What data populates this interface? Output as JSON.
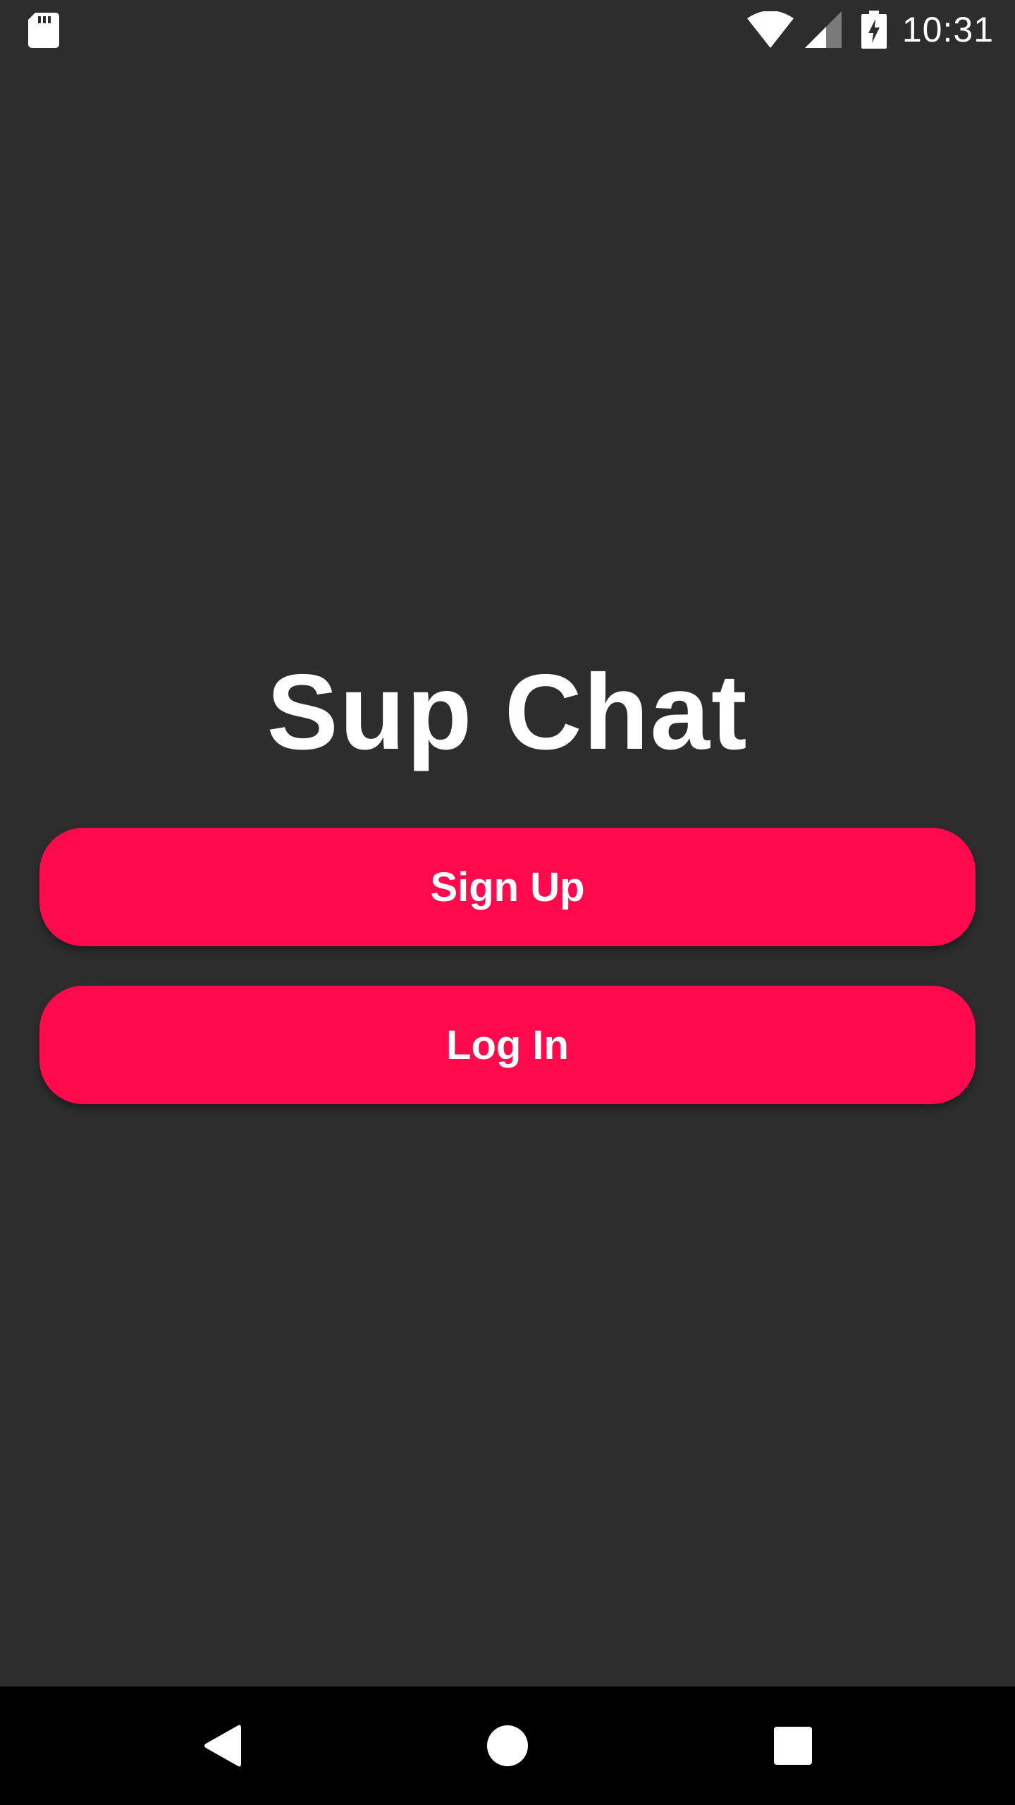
{
  "status_bar": {
    "time": "10:31",
    "icons": [
      "sd-card-icon",
      "wifi-icon",
      "cell-signal-icon",
      "battery-charging-icon"
    ]
  },
  "app": {
    "title": "Sup Chat"
  },
  "buttons": {
    "signup_label": "Sign Up",
    "login_label": "Log In"
  },
  "nav_bar": {
    "icons": [
      "back-icon",
      "home-icon",
      "recents-icon"
    ]
  },
  "colors": {
    "background": "#2d2d2d",
    "accent": "#ff0a4c",
    "text": "#ffffff",
    "nav_bar": "#000000"
  }
}
